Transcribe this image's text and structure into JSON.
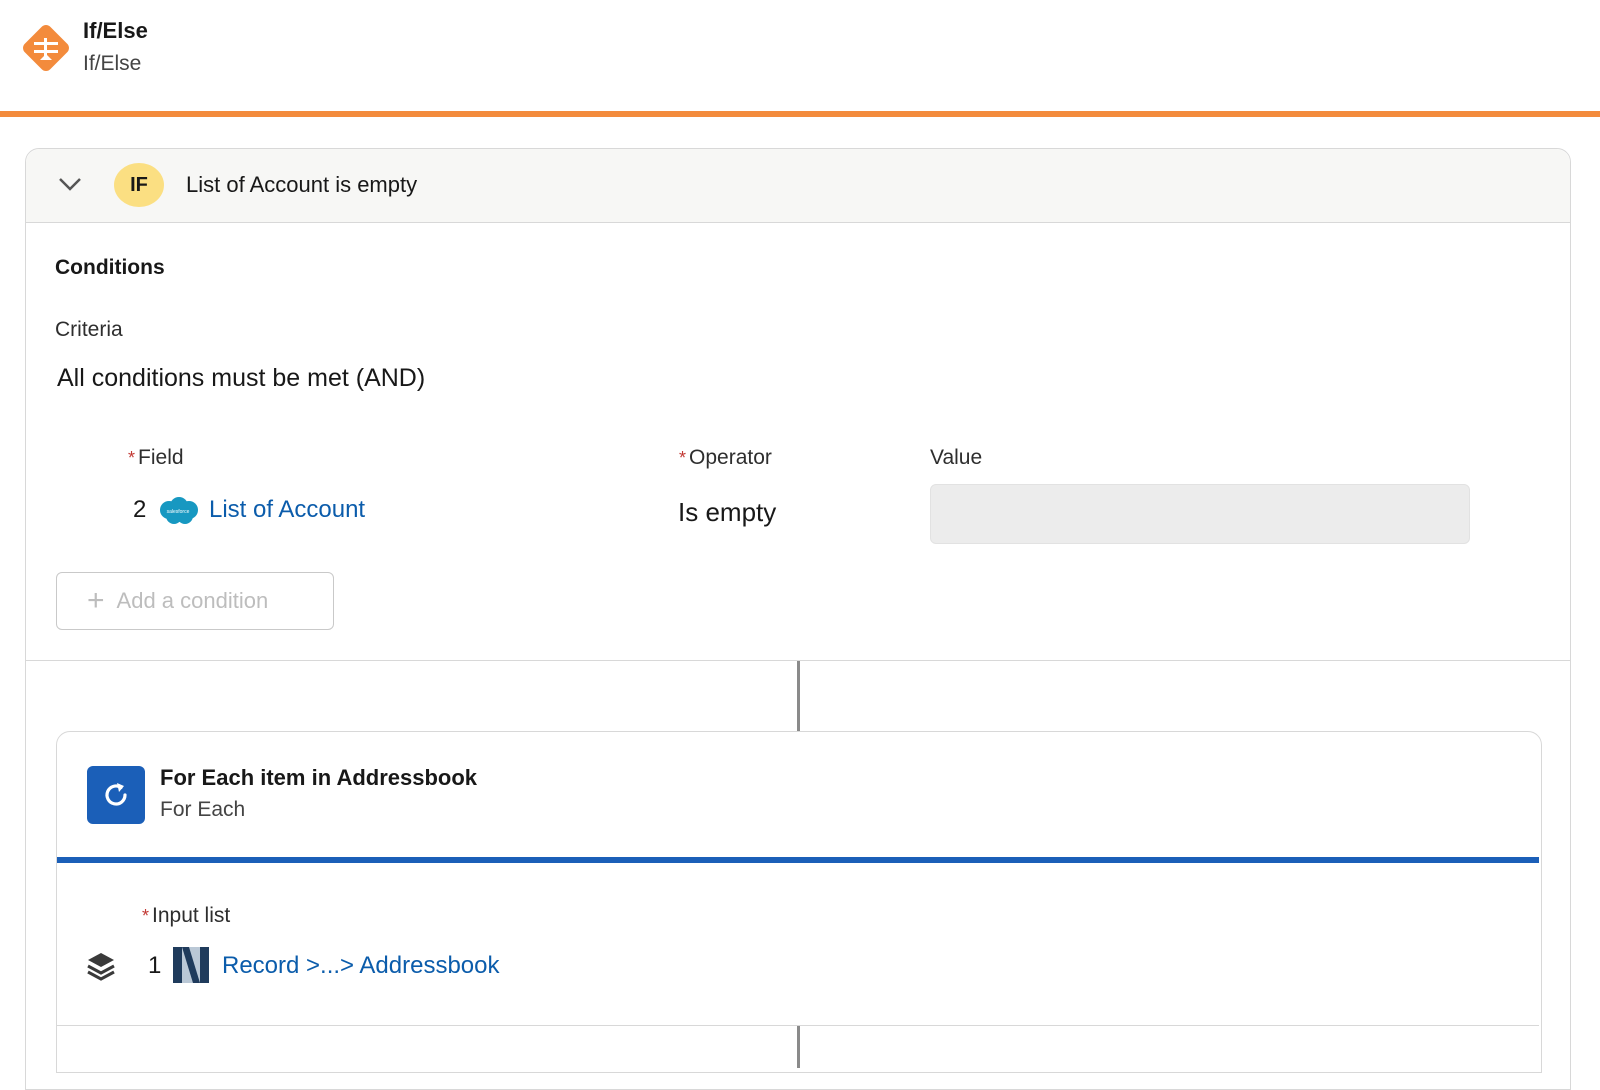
{
  "header": {
    "title": "If/Else",
    "subtitle": "If/Else",
    "icon": "if-else-branch-icon",
    "accent_color": "#f38b3c"
  },
  "if_block": {
    "badge": "IF",
    "badge_color": "#fbdf82",
    "title": "List of Account is empty",
    "conditions_heading": "Conditions",
    "criteria_label": "Criteria",
    "criteria_value": "All conditions must be met (AND)",
    "field_label": "Field",
    "operator_label": "Operator",
    "value_label": "Value",
    "required_marker": "*",
    "condition": {
      "field_step": "2",
      "field_source_icon": "salesforce-logo",
      "field_source_text": "salesforce",
      "field_name": "List of Account",
      "operator": "Is empty",
      "value": ""
    },
    "add_condition_label": "Add a condition"
  },
  "for_each": {
    "title": "For Each item in Addressbook",
    "subtitle": "For Each",
    "icon": "refresh-loop-icon",
    "accent_color": "#1b5fb8",
    "input_label": "Input list",
    "required_marker": "*",
    "input_step": "1",
    "input_source_icon": "netsuite-logo",
    "input_source_text": "N",
    "input_value": "Record >...> Addressbook"
  }
}
